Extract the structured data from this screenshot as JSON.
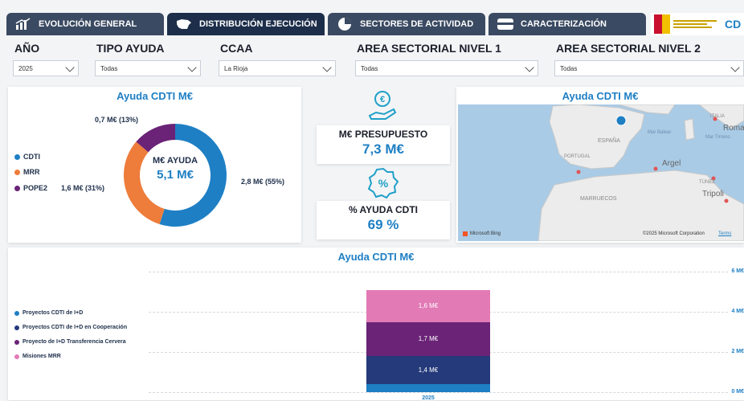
{
  "tabs": [
    {
      "label": "EVOLUCIÓN GENERAL",
      "icon": "bar-chart-icon"
    },
    {
      "label": "DISTRIBUCIÓN EJECUCIÓN",
      "icon": "spain-map-icon"
    },
    {
      "label": "SECTORES DE ACTIVIDAD",
      "icon": "pie-chart-icon"
    },
    {
      "label": "CARACTERIZACIÓN",
      "icon": "card-icon"
    }
  ],
  "header_logo_text": "CD",
  "filters": [
    {
      "label": "AÑO",
      "value": "2025"
    },
    {
      "label": "TIPO AYUDA",
      "value": "Todas"
    },
    {
      "label": "CCAA",
      "value": "La Rioja"
    },
    {
      "label": "AREA SECTORIAL NIVEL 1",
      "value": "Todas"
    },
    {
      "label": "AREA SECTORIAL NIVEL 2",
      "value": "Todas"
    }
  ],
  "donut": {
    "title": "Ayuda CDTI M€",
    "center_label": "M€ AYUDA",
    "center_value": "5,1 M€",
    "legend": [
      {
        "name": "CDTI",
        "color": "#1e7fc4"
      },
      {
        "name": "MRR",
        "color": "#ee7c3b"
      },
      {
        "name": "POPE2",
        "color": "#6a2377"
      }
    ],
    "labels": {
      "cdti": "2,8 M€ (55%)",
      "mrr": "1,6 M€ (31%)",
      "pope2": "0,7 M€ (13%)"
    }
  },
  "kpi_budget": {
    "title": "M€ PRESUPUESTO",
    "value": "7,3 M€",
    "icon": "money-hand-icon"
  },
  "kpi_pct": {
    "title": "% AYUDA CDTI",
    "value": "69 %",
    "icon": "percent-badge-icon"
  },
  "map": {
    "title": "Ayuda CDTI M€",
    "labels": {
      "espana": "ESPAÑA",
      "portugal": "PORTUGAL",
      "marruecos": "MARRUECOS",
      "argel": "Argel",
      "roma": "Roma",
      "italia": "ITALIA",
      "tunez": "TÚNEZ",
      "tripoli": "Tripoli",
      "mar_balear": "Mar Balear",
      "mar_tirreno": "Mar Tirreno"
    },
    "attribution_left": "Microsoft Bing",
    "attribution_right": "©2025 Microsoft Corporation",
    "terms": "Terms"
  },
  "bar": {
    "title": "Ayuda CDTI M€",
    "axis_labels": [
      "6 M€",
      "4 M€",
      "2 M€",
      "0 M€"
    ],
    "x_label": "2025",
    "legend": [
      {
        "name": "Proyectos CDTI de I+D",
        "color": "#1e7fc4"
      },
      {
        "name": "Proyectos CDTI de I+D en Cooperación",
        "color": "#243a7a"
      },
      {
        "name": "Proyecto de I+D Transferencia Cervera",
        "color": "#6a2377"
      },
      {
        "name": "Misiones MRR",
        "color": "#e27ab5"
      }
    ]
  },
  "chart_data": [
    {
      "type": "pie",
      "title": "Ayuda CDTI M€",
      "categories": [
        "CDTI",
        "MRR",
        "POPE2"
      ],
      "values": [
        2.8,
        1.6,
        0.7
      ],
      "percents": [
        55,
        31,
        13
      ]
    },
    {
      "type": "bar",
      "title": "Ayuda CDTI M€",
      "categories": [
        "2025"
      ],
      "series": [
        {
          "name": "Proyectos CDTI de I+D",
          "values": [
            0.4
          ]
        },
        {
          "name": "Proyectos CDTI de I+D en Cooperación",
          "values": [
            1.4
          ]
        },
        {
          "name": "Proyecto de I+D Transferencia Cervera",
          "values": [
            1.7
          ]
        },
        {
          "name": "Misiones MRR",
          "values": [
            1.6
          ]
        }
      ],
      "segment_labels": [
        "",
        "1,4 M€",
        "1,7 M€",
        "1,6 M€"
      ],
      "ylim": [
        0,
        6
      ]
    }
  ]
}
